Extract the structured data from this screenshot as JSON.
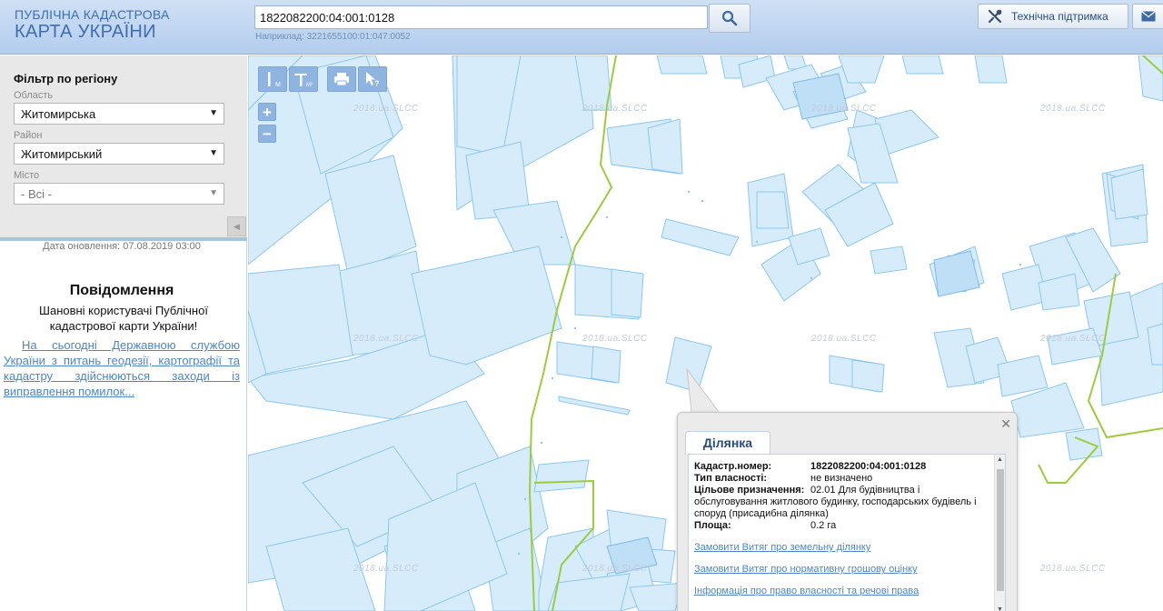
{
  "header": {
    "logo_line1": "ПУБЛІЧНА КАДАСТРОВА",
    "logo_line2": "КАРТА УКРАЇНИ",
    "search_value": "1822082200:04:001:0128",
    "example": "Наприклад: 3221655100:01:047:0052",
    "support_label": "Технічна підтримка",
    "icons": {
      "search": "search-icon",
      "support": "tools-icon",
      "mail": "envelope-icon"
    }
  },
  "filter": {
    "title": "Фільтр по регіону",
    "oblast_label": "Область",
    "oblast_value": "Житомирська",
    "rayon_label": "Район",
    "rayon_value": "Житомирський",
    "city_label": "Місто",
    "city_value": "- Всі -"
  },
  "update_text": "Дата оновлення: 07.08.2019 03:00",
  "notice": {
    "title": "Повідомлення",
    "text": "Шановні користувачі Публічної кадастрової карти України!",
    "link": "На сьогодні Державною службою України з питань геодезії, картографії та кадастру здійснюються заходи із виправлення помилок..."
  },
  "map": {
    "watermark": "2018.ua.SLCC",
    "tools": [
      "ruler-icon",
      "area-ruler-icon",
      "print-icon",
      "info-cursor-icon"
    ],
    "colors": {
      "parcel_fill": "#d6ecfb",
      "parcel_stroke": "#8cc7ee",
      "boundary": "#9ccc3c"
    }
  },
  "popup": {
    "tab": "Ділянка",
    "fields": {
      "cadastre_label": "Кадастр.номер:",
      "cadastre_value": "1822082200:04:001:0128",
      "ownership_label": "Тип власності:",
      "ownership_value": "не визначено",
      "purpose_label": "Цільове призначення:",
      "purpose_value": "02.01 Для будівництва і",
      "purpose_cont": "обслуговування житлового будинку, господарських будівель і споруд (присадибна ділянка)",
      "area_label": "Площа:",
      "area_value": "0.2 га"
    },
    "links": [
      "Замовити Витяг про земельну ділянку",
      "Замовити Витяг про нормативну грошову оцінку",
      "Інформація про право власності та речові права"
    ]
  }
}
